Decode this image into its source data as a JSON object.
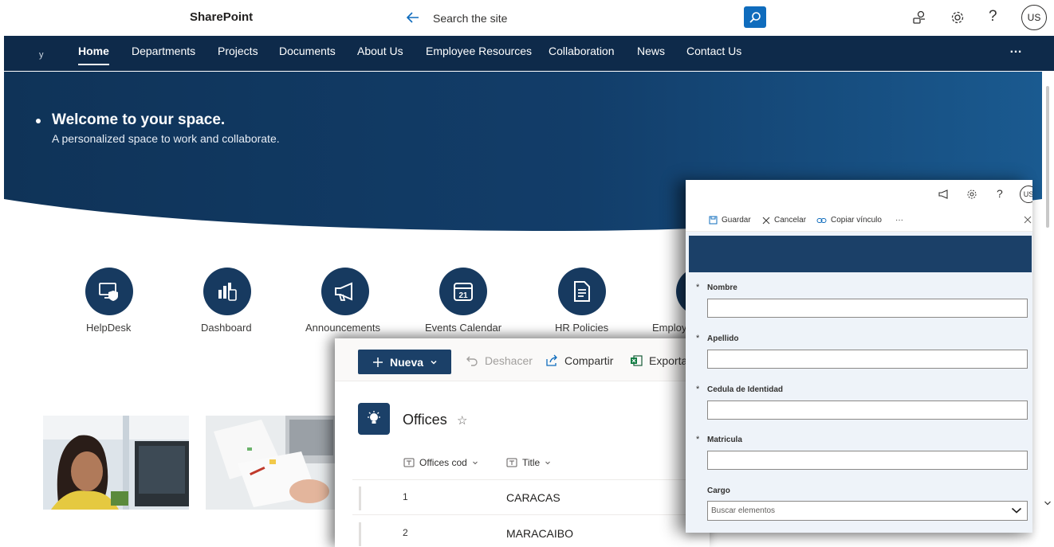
{
  "suite": {
    "brand": "SharePoint",
    "search_placeholder": "Search the site",
    "avatar": "US"
  },
  "nav": {
    "site_mark": "y",
    "items": [
      {
        "label": "Home"
      },
      {
        "label": "Departments"
      },
      {
        "label": "Projects"
      },
      {
        "label": "Documents"
      },
      {
        "label": "About Us"
      },
      {
        "label": "Employee Resources"
      },
      {
        "label": "Collaboration"
      },
      {
        "label": "News"
      },
      {
        "label": "Contact Us"
      }
    ],
    "more": "…"
  },
  "hero": {
    "title": "Welcome to your space.",
    "subtitle": "A personalized space to work and collaborate."
  },
  "quick_links": [
    {
      "label": "HelpDesk",
      "icon": "helpdesk-monitor-shield-icon"
    },
    {
      "label": "Dashboard",
      "icon": "dashboard-chart-icon"
    },
    {
      "label": "Announcements",
      "icon": "megaphone-icon"
    },
    {
      "label": "Events Calendar",
      "icon": "calendar-icon",
      "icon_text": "21"
    },
    {
      "label": "HR Policies",
      "icon": "policy-document-icon"
    },
    {
      "label": "Employ",
      "icon": "employee-icon"
    }
  ],
  "list_panel": {
    "new_label": "Nueva",
    "undo_label": "Deshacer",
    "share_label": "Compartir",
    "export_label": "Exporta",
    "title": "Offices",
    "columns": [
      "Offices cod",
      "Title"
    ],
    "rows": [
      {
        "code": "1",
        "title": "CARACAS"
      },
      {
        "code": "2",
        "title": "MARACAIBO"
      }
    ]
  },
  "form_panel": {
    "avatar": "US",
    "save_label": "Guardar",
    "cancel_label": "Cancelar",
    "copy_link_label": "Copiar vínculo",
    "more": "···",
    "fields": [
      {
        "label": "Nombre",
        "required": "*",
        "value": ""
      },
      {
        "label": "Apellido",
        "required": "*",
        "value": ""
      },
      {
        "label": "Cedula de Identidad",
        "required": "*",
        "value": ""
      },
      {
        "label": "Matricula",
        "required": "*",
        "value": ""
      }
    ],
    "select_field": {
      "label": "Cargo",
      "placeholder": "Buscar elementos"
    }
  },
  "colors": {
    "nav_bg": "#0e2a4a",
    "accent": "#1b4068",
    "search_button": "#0f6cbd"
  }
}
